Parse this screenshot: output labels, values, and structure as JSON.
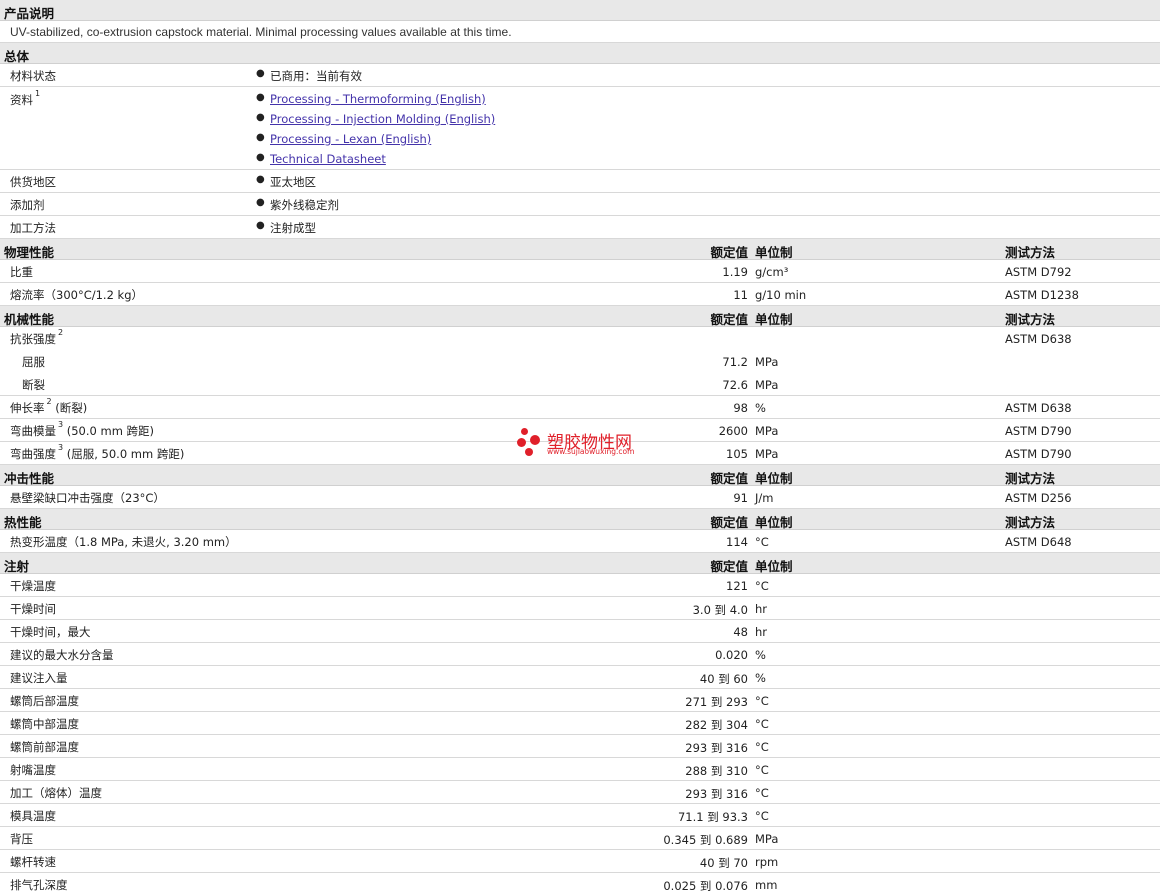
{
  "product_desc": {
    "title": "产品说明",
    "text": "UV-stabilized, co-extrusion capstock material. Minimal processing values available at this time."
  },
  "general": {
    "title": "总体",
    "status_label": "材料状态",
    "status_value": "已商用：当前有效",
    "docs_label": "资料",
    "docs_sup": "1",
    "docs": [
      "Processing - Thermoforming (English)",
      "Processing - Injection Molding (English)",
      "Processing - Lexan (English)",
      "Technical Datasheet"
    ],
    "region_label": "供货地区",
    "region_value": "亚太地区",
    "additive_label": "添加剂",
    "additive_value": "紫外线稳定剂",
    "method_label": "加工方法",
    "method_value": "注射成型"
  },
  "headers": {
    "value": "额定值",
    "unit": "单位制",
    "test": "测试方法"
  },
  "physical": {
    "title": "物理性能",
    "rows": [
      {
        "label": "比重",
        "value": "1.19",
        "unit": "g/cm³",
        "test": "ASTM D792"
      },
      {
        "label": "熔流率（300°C/1.2 kg）",
        "value": "11",
        "unit": "g/10 min",
        "test": "ASTM D1238"
      }
    ]
  },
  "mechanical": {
    "title": "机械性能",
    "tensile_label": "抗张强度",
    "tensile_sup": "2",
    "tensile_test": "ASTM D638",
    "yield_label": "屈服",
    "yield_value": "71.2",
    "yield_unit": "MPa",
    "break_label": "断裂",
    "break_value": "72.6",
    "break_unit": "MPa",
    "elong_label": "伸长率",
    "elong_sup": "2",
    "elong_suffix": "(断裂)",
    "elong_value": "98",
    "elong_unit": "%",
    "elong_test": "ASTM D638",
    "flexmod_label": "弯曲模量",
    "flexmod_sup": "3",
    "flexmod_suffix": "(50.0 mm 跨距)",
    "flexmod_value": "2600",
    "flexmod_unit": "MPa",
    "flexmod_test": "ASTM D790",
    "flexstr_label": "弯曲强度",
    "flexstr_sup": "3",
    "flexstr_suffix": "(屈服, 50.0 mm 跨距)",
    "flexstr_value": "105",
    "flexstr_unit": "MPa",
    "flexstr_test": "ASTM D790"
  },
  "impact": {
    "title": "冲击性能",
    "label": "悬壁梁缺口冲击强度（23°C）",
    "value": "91",
    "unit": "J/m",
    "test": "ASTM D256"
  },
  "thermal": {
    "title": "热性能",
    "label": "热变形温度（1.8 MPa, 未退火, 3.20 mm）",
    "value": "114",
    "unit": "°C",
    "test": "ASTM D648"
  },
  "injection": {
    "title": "注射",
    "rows": [
      {
        "label": "干燥温度",
        "value": "121",
        "unit": "°C"
      },
      {
        "label": "干燥时间",
        "value": "3.0 到  4.0",
        "unit": "hr"
      },
      {
        "label": "干燥时间，最大",
        "value": "48",
        "unit": "hr"
      },
      {
        "label": "建议的最大水分含量",
        "value": "0.020",
        "unit": "%"
      },
      {
        "label": "建议注入量",
        "value": "40 到  60",
        "unit": "%"
      },
      {
        "label": "螺筒后部温度",
        "value": "271 到  293",
        "unit": "°C"
      },
      {
        "label": "螺筒中部温度",
        "value": "282 到  304",
        "unit": "°C"
      },
      {
        "label": "螺筒前部温度",
        "value": "293 到  316",
        "unit": "°C"
      },
      {
        "label": "射嘴温度",
        "value": "288 到  310",
        "unit": "°C"
      },
      {
        "label": "加工（熔体）温度",
        "value": "293 到  316",
        "unit": "°C"
      },
      {
        "label": "模具温度",
        "value": "71.1 到  93.3",
        "unit": "°C"
      },
      {
        "label": "背压",
        "value": "0.345 到  0.689",
        "unit": "MPa"
      },
      {
        "label": "螺杆转速",
        "value": "40 到  70",
        "unit": "rpm"
      },
      {
        "label": "排气孔深度",
        "value": "0.025 到  0.076",
        "unit": "mm"
      }
    ]
  },
  "watermark": {
    "name": "塑胶物性网",
    "url": "www.sujiaowuxing.com"
  }
}
